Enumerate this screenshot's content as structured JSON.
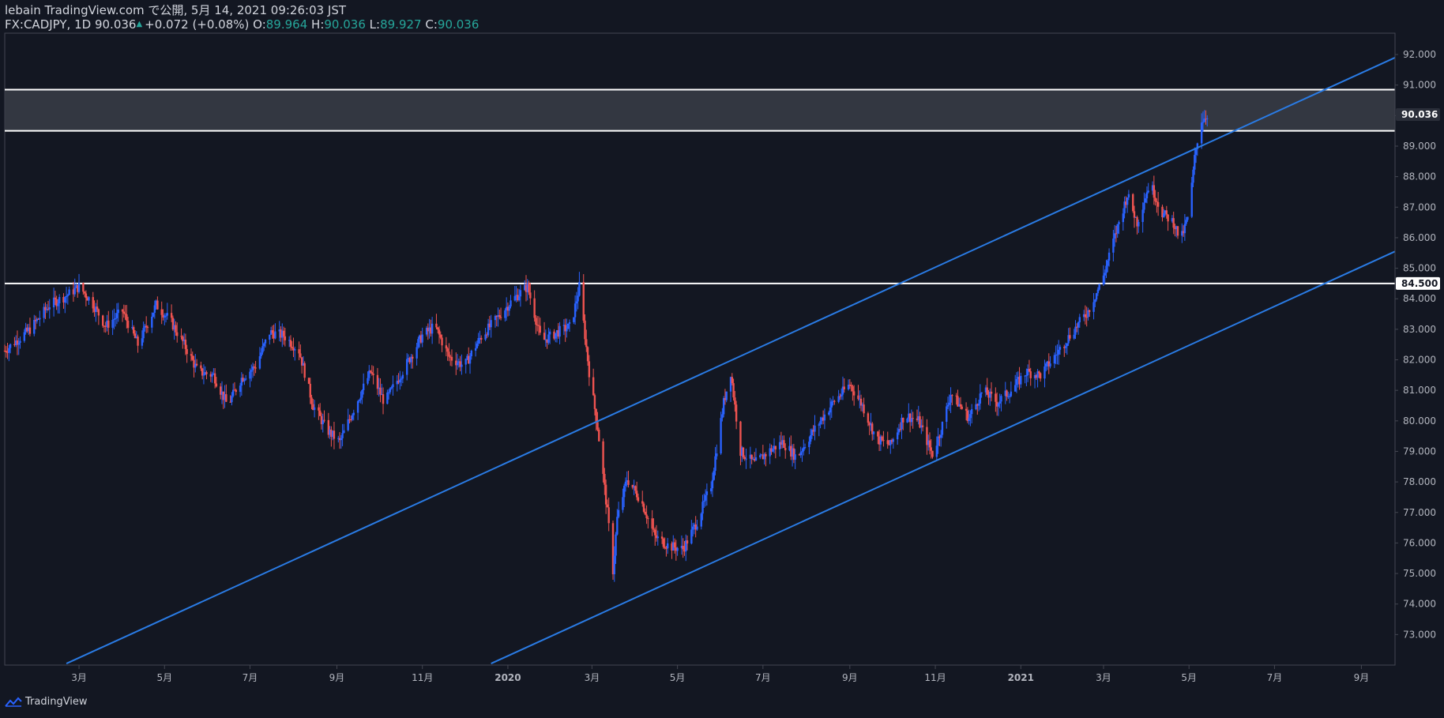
{
  "header": {
    "published": "lebain TradingView.com で公開, 5月 14, 2021 09:26:03 JST",
    "symbol": "FX:CADJPY, 1D",
    "last": "90.036",
    "change": "+0.072 (+0.08%)",
    "o_label": "O:",
    "o_value": "89.964",
    "h_label": "H:",
    "h_value": "90.036",
    "l_label": "L:",
    "l_value": "89.927",
    "c_label": "C:",
    "c_value": "90.036"
  },
  "footer": {
    "brand": "TradingView"
  },
  "colors": {
    "background": "#131722",
    "up": "#2962ff",
    "down": "#ef5350",
    "channel": "#2a7be4",
    "level": "#ffffff",
    "zone": "#3a3d46",
    "axis_text": "#b2b5be"
  },
  "chart_data": {
    "type": "candlestick",
    "symbol": "FX:CADJPY",
    "interval": "1D",
    "ylim": [
      72.0,
      92.7
    ],
    "y_ticks": [
      73,
      74,
      75,
      76,
      77,
      78,
      79,
      80,
      81,
      82,
      83,
      84,
      85,
      86,
      87,
      88,
      89,
      90,
      91,
      92
    ],
    "y_tick_labels": [
      "73.000",
      "74.000",
      "75.000",
      "76.000",
      "77.000",
      "78.000",
      "79.000",
      "80.000",
      "81.000",
      "82.000",
      "83.000",
      "84.000",
      "85.000",
      "86.000",
      "87.000",
      "88.000",
      "89.000",
      "90.000",
      "91.000",
      "92.000"
    ],
    "x_start": "2019-01-07",
    "x_end": "2021-09-25",
    "x_ticks": [
      {
        "date": "2019-03-01",
        "label": "3月"
      },
      {
        "date": "2019-05-01",
        "label": "5月"
      },
      {
        "date": "2019-07-01",
        "label": "7月"
      },
      {
        "date": "2019-09-01",
        "label": "9月"
      },
      {
        "date": "2019-11-01",
        "label": "11月"
      },
      {
        "date": "2020-01-01",
        "label": "2020"
      },
      {
        "date": "2020-03-01",
        "label": "3月"
      },
      {
        "date": "2020-05-01",
        "label": "5月"
      },
      {
        "date": "2020-07-01",
        "label": "7月"
      },
      {
        "date": "2020-09-01",
        "label": "9月"
      },
      {
        "date": "2020-11-01",
        "label": "11月"
      },
      {
        "date": "2021-01-01",
        "label": "2021"
      },
      {
        "date": "2021-03-01",
        "label": "3月"
      },
      {
        "date": "2021-05-01",
        "label": "5月"
      },
      {
        "date": "2021-07-01",
        "label": "7月"
      },
      {
        "date": "2021-09-01",
        "label": "9月"
      }
    ],
    "price_path": [
      [
        "2019-01-07",
        82.3
      ],
      [
        "2019-01-25",
        83.0
      ],
      [
        "2019-02-08",
        83.8
      ],
      [
        "2019-02-20",
        84.1
      ],
      [
        "2019-03-01",
        84.4
      ],
      [
        "2019-03-10",
        83.9
      ],
      [
        "2019-03-20",
        83.1
      ],
      [
        "2019-04-01",
        83.6
      ],
      [
        "2019-04-12",
        82.5
      ],
      [
        "2019-04-25",
        83.8
      ],
      [
        "2019-05-05",
        83.3
      ],
      [
        "2019-05-15",
        82.5
      ],
      [
        "2019-05-25",
        81.6
      ],
      [
        "2019-06-05",
        81.5
      ],
      [
        "2019-06-15",
        80.5
      ],
      [
        "2019-06-25",
        81.4
      ],
      [
        "2019-07-05",
        81.8
      ],
      [
        "2019-07-15",
        82.9
      ],
      [
        "2019-07-25",
        82.8
      ],
      [
        "2019-08-05",
        82.3
      ],
      [
        "2019-08-15",
        80.5
      ],
      [
        "2019-08-25",
        79.7
      ],
      [
        "2019-09-03",
        79.3
      ],
      [
        "2019-09-15",
        80.6
      ],
      [
        "2019-09-25",
        81.6
      ],
      [
        "2019-10-05",
        80.6
      ],
      [
        "2019-10-20",
        81.8
      ],
      [
        "2019-11-01",
        82.8
      ],
      [
        "2019-11-10",
        83.1
      ],
      [
        "2019-11-20",
        82.1
      ],
      [
        "2019-12-01",
        81.8
      ],
      [
        "2019-12-12",
        82.7
      ],
      [
        "2019-12-25",
        83.4
      ],
      [
        "2020-01-05",
        84.0
      ],
      [
        "2020-01-15",
        84.4
      ],
      [
        "2020-01-25",
        82.6
      ],
      [
        "2020-02-05",
        82.9
      ],
      [
        "2020-02-15",
        83.1
      ],
      [
        "2020-02-21",
        84.4
      ],
      [
        "2020-02-28",
        81.6
      ],
      [
        "2020-03-05",
        79.8
      ],
      [
        "2020-03-12",
        77.0
      ],
      [
        "2020-03-16",
        75.1
      ],
      [
        "2020-03-19",
        76.8
      ],
      [
        "2020-03-26",
        78.1
      ],
      [
        "2020-04-05",
        77.4
      ],
      [
        "2020-04-15",
        76.2
      ],
      [
        "2020-04-25",
        75.9
      ],
      [
        "2020-05-05",
        75.8
      ],
      [
        "2020-05-15",
        76.7
      ],
      [
        "2020-05-25",
        77.9
      ],
      [
        "2020-06-03",
        80.6
      ],
      [
        "2020-06-08",
        81.6
      ],
      [
        "2020-06-15",
        79.0
      ],
      [
        "2020-06-25",
        78.6
      ],
      [
        "2020-07-05",
        79.0
      ],
      [
        "2020-07-15",
        79.3
      ],
      [
        "2020-07-25",
        78.8
      ],
      [
        "2020-08-05",
        79.6
      ],
      [
        "2020-08-20",
        80.6
      ],
      [
        "2020-09-01",
        81.2
      ],
      [
        "2020-09-10",
        80.5
      ],
      [
        "2020-09-20",
        79.4
      ],
      [
        "2020-09-30",
        79.2
      ],
      [
        "2020-10-10",
        80.2
      ],
      [
        "2020-10-20",
        80.0
      ],
      [
        "2020-10-30",
        78.9
      ],
      [
        "2020-11-05",
        79.7
      ],
      [
        "2020-11-12",
        80.9
      ],
      [
        "2020-11-25",
        80.1
      ],
      [
        "2020-12-05",
        81.0
      ],
      [
        "2020-12-15",
        80.6
      ],
      [
        "2020-12-25",
        81.0
      ],
      [
        "2021-01-05",
        81.6
      ],
      [
        "2021-01-15",
        81.5
      ],
      [
        "2021-01-25",
        82.1
      ],
      [
        "2021-02-05",
        82.8
      ],
      [
        "2021-02-18",
        83.6
      ],
      [
        "2021-02-28",
        84.6
      ],
      [
        "2021-03-10",
        86.2
      ],
      [
        "2021-03-18",
        87.4
      ],
      [
        "2021-03-25",
        86.5
      ],
      [
        "2021-04-03",
        87.8
      ],
      [
        "2021-04-12",
        86.8
      ],
      [
        "2021-04-20",
        86.5
      ],
      [
        "2021-04-25",
        85.9
      ],
      [
        "2021-05-01",
        86.8
      ],
      [
        "2021-05-05",
        88.6
      ],
      [
        "2021-05-09",
        89.8
      ],
      [
        "2021-05-14",
        90.036
      ]
    ],
    "horizontal_levels": [
      90.85,
      89.5,
      84.5
    ],
    "resistance_zone": [
      89.5,
      90.85
    ],
    "price_labels": [
      {
        "value": 90.036,
        "text": "90.036"
      },
      {
        "value": 84.5,
        "text": "84.500"
      }
    ],
    "channel_lines": [
      {
        "p1": [
          "2019-02-20",
          72.05
        ],
        "p2": [
          "2021-09-25",
          91.9
        ]
      },
      {
        "p1": [
          "2019-12-20",
          72.05
        ],
        "p2": [
          "2021-09-25",
          85.55
        ]
      }
    ]
  }
}
